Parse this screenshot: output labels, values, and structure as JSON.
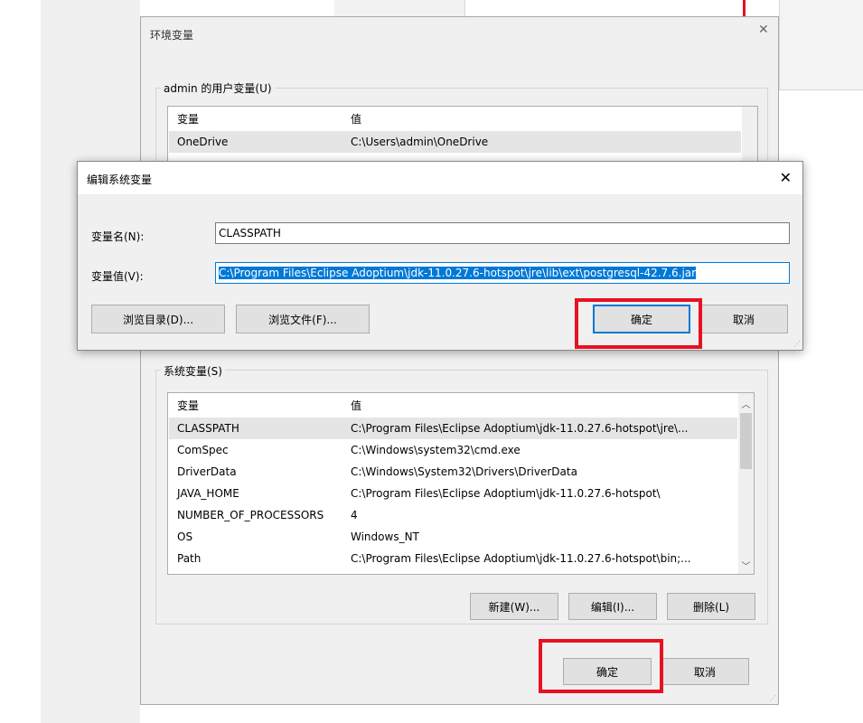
{
  "env_window": {
    "title": "环境变量",
    "user_vars": {
      "label": "admin 的用户变量(U)",
      "headers": {
        "name": "变量",
        "value": "值"
      },
      "rows": [
        {
          "name": "OneDrive",
          "value": "C:\\Users\\admin\\OneDrive"
        }
      ]
    },
    "system_vars": {
      "label": "系统变量(S)",
      "headers": {
        "name": "变量",
        "value": "值"
      },
      "rows": [
        {
          "name": "CLASSPATH",
          "value": "C:\\Program Files\\Eclipse Adoptium\\jdk-11.0.27.6-hotspot\\jre\\..."
        },
        {
          "name": "ComSpec",
          "value": "C:\\Windows\\system32\\cmd.exe"
        },
        {
          "name": "DriverData",
          "value": "C:\\Windows\\System32\\Drivers\\DriverData"
        },
        {
          "name": "JAVA_HOME",
          "value": "C:\\Program Files\\Eclipse Adoptium\\jdk-11.0.27.6-hotspot\\"
        },
        {
          "name": "NUMBER_OF_PROCESSORS",
          "value": "4"
        },
        {
          "name": "OS",
          "value": "Windows_NT"
        },
        {
          "name": "Path",
          "value": "C:\\Program Files\\Eclipse Adoptium\\jdk-11.0.27.6-hotspot\\bin;..."
        }
      ],
      "buttons": {
        "new": "新建(W)...",
        "edit": "编辑(I)...",
        "delete": "删除(L)"
      }
    },
    "buttons": {
      "ok": "确定",
      "cancel": "取消"
    }
  },
  "edit_dialog": {
    "title": "编辑系统变量",
    "name_label": "变量名(N):",
    "name_value": "CLASSPATH",
    "value_label": "变量值(V):",
    "value_value": "C:\\Program Files\\Eclipse Adoptium\\jdk-11.0.27.6-hotspot\\jre\\lib\\ext\\postgresql-42.7.6.jar",
    "buttons": {
      "browse_dir": "浏览目录(D)...",
      "browse_file": "浏览文件(F)...",
      "ok": "确定",
      "cancel": "取消"
    }
  },
  "icons": {
    "close": "close-icon",
    "scroll_up": "chevron-up-icon",
    "scroll_down": "chevron-down-icon"
  },
  "colors": {
    "highlight": "#e81123",
    "selection": "#0078d7",
    "dialog_bg": "#f0f0f0"
  }
}
